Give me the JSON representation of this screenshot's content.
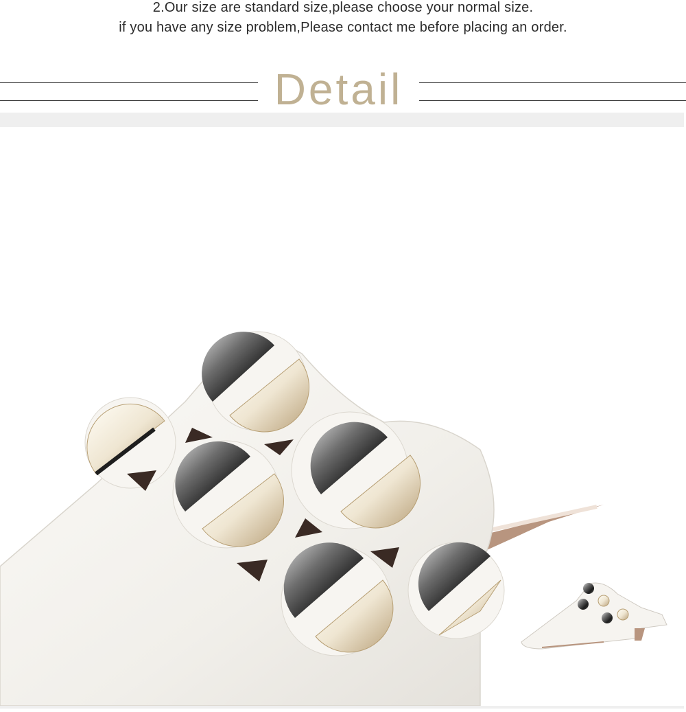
{
  "size_note": {
    "line1": "2.Our size are standard size,please choose your normal size.",
    "line2": "if you have any size problem,Please contact me before placing an order."
  },
  "section": {
    "title": "Detail"
  },
  "colors": {
    "title": "#c0b193",
    "rules": "#3a3a3a",
    "frame": "#efefef",
    "leather": "#f4f2ee",
    "gunmetal": "#2e2e2e",
    "gold": "#d8c39a"
  },
  "photo": {
    "subject": "white-pointed-mule-closeup",
    "inset": "white-pointed-mule-side-view"
  }
}
